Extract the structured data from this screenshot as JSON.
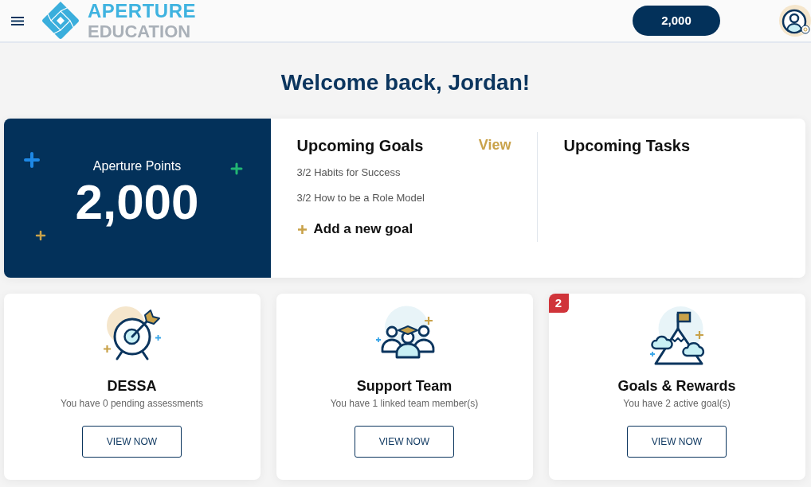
{
  "header": {
    "logo": {
      "line_1": "APERTURE",
      "line_2": "EDUCATION"
    },
    "points": "2,000"
  },
  "welcome": "Welcome back, Jordan!",
  "points_card": {
    "label": "Aperture Points",
    "value": "2,000"
  },
  "upcoming_goals": {
    "title": "Upcoming Goals",
    "link": "View",
    "items": [
      "3/2 Habits for Success",
      "3/2 How to be a Role Model"
    ],
    "add_label": "Add a new goal"
  },
  "upcoming_tasks": {
    "title": "Upcoming Tasks"
  },
  "cards": [
    {
      "kind": "target",
      "title": "DESSA",
      "subtitle": "You have 0 pending assessments",
      "button": "VIEW NOW"
    },
    {
      "kind": "team",
      "title": "Support Team",
      "subtitle": "You have 1 linked team member(s)",
      "button": "VIEW NOW"
    },
    {
      "kind": "mountain",
      "title": "Goals & Rewards",
      "subtitle": "You have 2 active goal(s)",
      "button": "VIEW NOW",
      "badge": "2"
    }
  ]
}
